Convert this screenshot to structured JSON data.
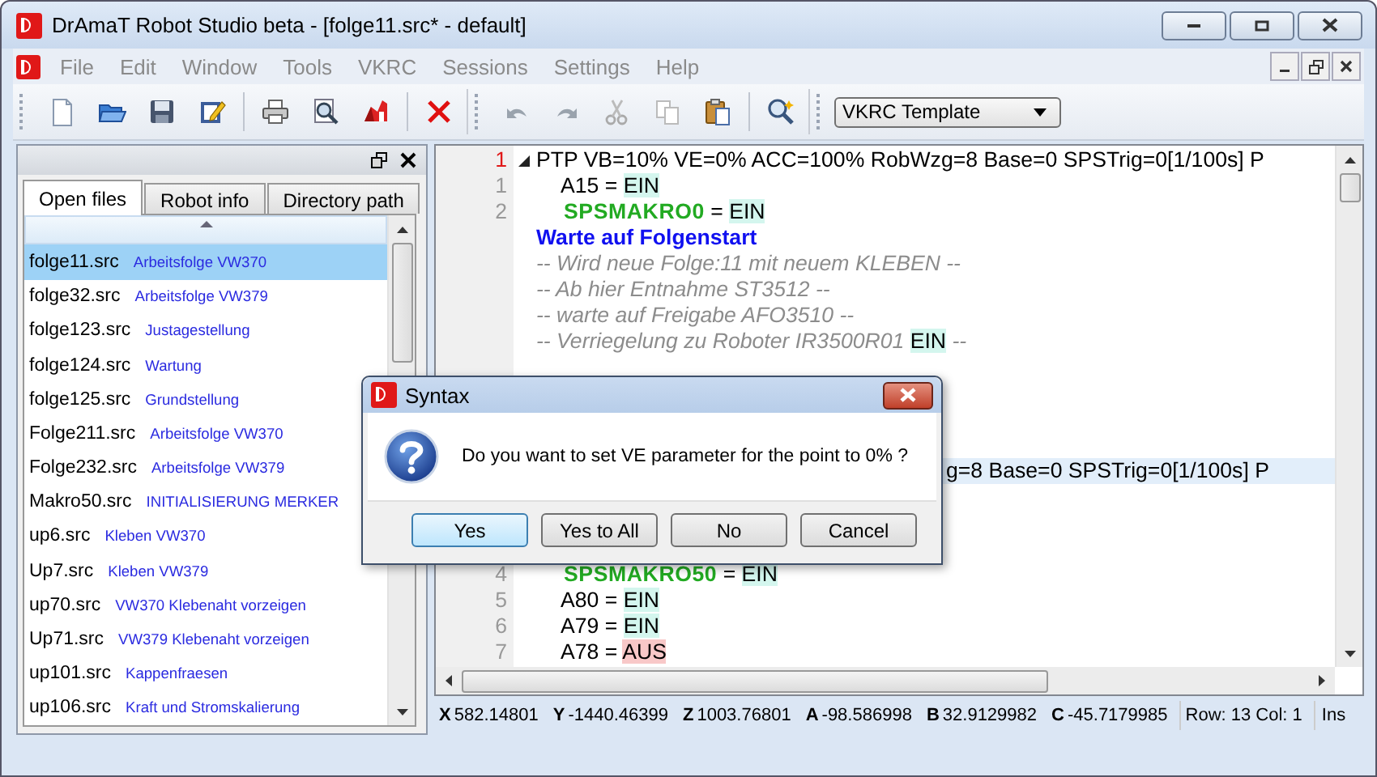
{
  "window": {
    "title": "DrAmaT Robot Studio beta - [folge11.src* - default]"
  },
  "menu": [
    {
      "label": "File",
      "disabled": true
    },
    {
      "label": "Edit",
      "disabled": true
    },
    {
      "label": "Window",
      "disabled": true
    },
    {
      "label": "Tools",
      "disabled": true
    },
    {
      "label": "VKRC",
      "disabled": true
    },
    {
      "label": "Sessions",
      "disabled": true
    },
    {
      "label": "Settings",
      "disabled": true
    },
    {
      "label": "Help",
      "disabled": true
    }
  ],
  "template_select": {
    "value": "VKRC Template"
  },
  "side_panel": {
    "tabs": [
      {
        "label": "Open files",
        "selected": true
      },
      {
        "label": "Robot info",
        "selected": false
      },
      {
        "label": "Directory path",
        "selected": false
      }
    ],
    "files": [
      {
        "name": "folge11.src",
        "description": "Arbeitsfolge VW370",
        "selected": true
      },
      {
        "name": "folge32.src",
        "description": "Arbeitsfolge VW379",
        "selected": false
      },
      {
        "name": "folge123.src",
        "description": "Justagestellung",
        "selected": false
      },
      {
        "name": "folge124.src",
        "description": "Wartung",
        "selected": false
      },
      {
        "name": "folge125.src",
        "description": "Grundstellung",
        "selected": false
      },
      {
        "name": "Folge211.src",
        "description": "Arbeitsfolge VW370",
        "selected": false
      },
      {
        "name": "Folge232.src",
        "description": "Arbeitsfolge VW379",
        "selected": false
      },
      {
        "name": "Makro50.src",
        "description": "INITIALISIERUNG MERKER",
        "selected": false
      },
      {
        "name": "up6.src",
        "description": "Kleben VW370",
        "selected": false
      },
      {
        "name": "Up7.src",
        "description": "Kleben VW379",
        "selected": false
      },
      {
        "name": "up70.src",
        "description": "VW370 Klebenaht vorzeigen",
        "selected": false
      },
      {
        "name": "Up71.src",
        "description": "VW379 Klebenaht vorzeigen",
        "selected": false
      },
      {
        "name": "up101.src",
        "description": "Kappenfraesen",
        "selected": false
      },
      {
        "name": "up106.src",
        "description": "Kraft und Stromskalierung",
        "selected": false
      }
    ]
  },
  "editor": {
    "lines": [
      {
        "kind": "code",
        "number": "1",
        "marked": true,
        "fold": true,
        "selected": false,
        "segments": [
          {
            "kind": "plain",
            "text": "PTP VB=10% VE=0% ACC=100% RobWzg=8 Base=0 SPSTrig=0[1/100s] P"
          }
        ],
        "children": [
          {
            "kind": "code",
            "number": "1",
            "marked": false,
            "selected": false,
            "segments": [
              {
                "kind": "plain",
                "text": "A15 = "
              },
              {
                "kind": "on",
                "text": "EIN"
              }
            ]
          },
          {
            "kind": "code",
            "number": "2",
            "marked": false,
            "selected": false,
            "segments": [
              {
                "kind": "macro",
                "text": "SPSMAKRO0"
              },
              {
                "kind": "plain",
                "text": " = "
              },
              {
                "kind": "on",
                "text": "EIN"
              }
            ]
          }
        ]
      },
      {
        "kind": "code",
        "selected": false,
        "segments": [
          {
            "kind": "heading",
            "text": "Warte auf Folgenstart"
          }
        ]
      },
      {
        "kind": "code",
        "selected": false,
        "segments": [
          {
            "kind": "comment",
            "text": "-- Wird neue Folge:11 mit neuem  KLEBEN --"
          }
        ]
      },
      {
        "kind": "code",
        "selected": false,
        "segments": [
          {
            "kind": "comment",
            "text": "-- Ab  hier  Entnahme ST3512 --"
          }
        ]
      },
      {
        "kind": "code",
        "selected": false,
        "segments": [
          {
            "kind": "comment",
            "text": "-- warte auf Freigabe AFO3510 --"
          }
        ]
      },
      {
        "kind": "code",
        "selected": false,
        "segments": [
          {
            "kind": "comment",
            "text": "-- Verriegelung zu Roboter IR3500R01 "
          },
          {
            "kind": "on",
            "text": "EIN"
          },
          {
            "kind": "comment",
            "text": " --"
          }
        ]
      },
      {
        "kind": "covered"
      },
      {
        "kind": "covered"
      },
      {
        "kind": "covered"
      },
      {
        "kind": "covered"
      },
      {
        "kind": "partial",
        "selected": true,
        "segments": [
          {
            "kind": "plain",
            "text": "g=8 Base=0 SPSTrig=0[1/100s] P"
          }
        ]
      },
      {
        "kind": "covered"
      },
      {
        "kind": "covered"
      },
      {
        "kind": "covered"
      },
      {
        "kind": "code",
        "number": "4",
        "marked": false,
        "selected": false,
        "indented": true,
        "segments": [
          {
            "kind": "macro",
            "text": "SPSMAKRO50"
          },
          {
            "kind": "plain",
            "text": " = "
          },
          {
            "kind": "on",
            "text": "EIN"
          }
        ]
      },
      {
        "kind": "code",
        "number": "5",
        "marked": false,
        "selected": false,
        "indented": true,
        "segments": [
          {
            "kind": "plain",
            "text": "A80 = "
          },
          {
            "kind": "on",
            "text": "EIN"
          }
        ]
      },
      {
        "kind": "code",
        "number": "6",
        "marked": false,
        "selected": false,
        "indented": true,
        "segments": [
          {
            "kind": "plain",
            "text": "A79 = "
          },
          {
            "kind": "on",
            "text": "EIN"
          }
        ]
      },
      {
        "kind": "code",
        "number": "7",
        "marked": false,
        "selected": false,
        "indented": true,
        "segments": [
          {
            "kind": "plain",
            "text": "A78 = "
          },
          {
            "kind": "off",
            "text": "AUS"
          }
        ]
      }
    ]
  },
  "status_bar": {
    "coordinates": [
      {
        "axis": "X",
        "value": "582.14801"
      },
      {
        "axis": "Y",
        "value": "-1440.46399"
      },
      {
        "axis": "Z",
        "value": "1003.76801"
      },
      {
        "axis": "A",
        "value": "-98.586998"
      },
      {
        "axis": "B",
        "value": "32.9129982"
      },
      {
        "axis": "C",
        "value": "-45.7179985"
      }
    ],
    "position": "Row: 13 Col: 1",
    "mode": "Ins"
  },
  "dialog": {
    "title": "Syntax",
    "message": "Do you want to set VE parameter for the point to 0% ?",
    "buttons": [
      {
        "label": "Yes",
        "selected": true
      },
      {
        "label": "Yes to All",
        "selected": false
      },
      {
        "label": "No",
        "selected": false
      },
      {
        "label": "Cancel",
        "selected": false
      }
    ]
  }
}
